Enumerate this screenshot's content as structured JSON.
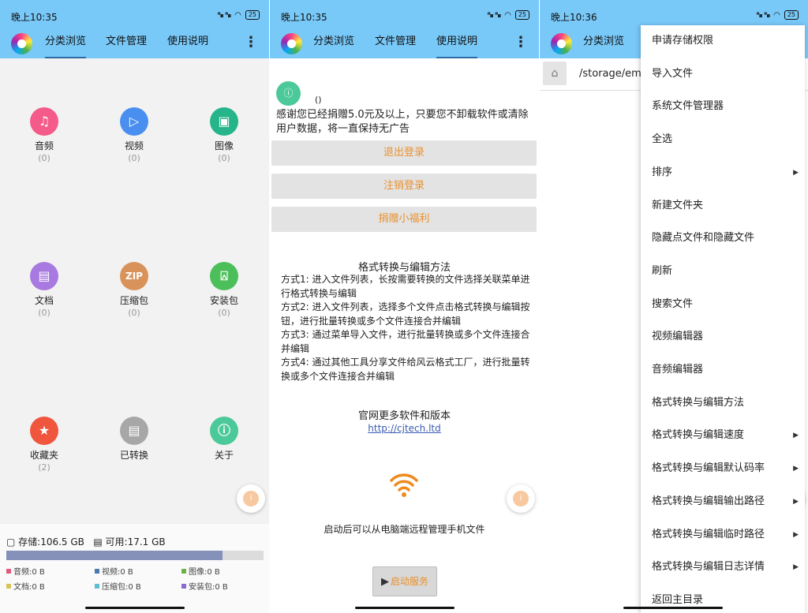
{
  "status": {
    "times": [
      "晚上10:35",
      "晚上10:35",
      "晚上10:36"
    ],
    "signal": "ᵃᵢₗₗ ᵃᵢₗₗ",
    "wifi": "📶",
    "battery": "25"
  },
  "tabs": [
    "分类浏览",
    "文件管理",
    "使用说明"
  ],
  "categories": [
    {
      "label": "音频",
      "count": "(0)",
      "icon": "♫",
      "color": "#f45a8a"
    },
    {
      "label": "视频",
      "count": "(0)",
      "icon": "▷",
      "color": "#4a8ff0"
    },
    {
      "label": "图像",
      "count": "(0)",
      "icon": "▣",
      "color": "#26b58a"
    },
    {
      "label": "文档",
      "count": "(0)",
      "icon": "▤",
      "color": "#a879e0"
    },
    {
      "label": "压缩包",
      "count": "(0)",
      "icon": "ZIP",
      "color": "#d9925a"
    },
    {
      "label": "安装包",
      "count": "(0)",
      "icon": "⍓",
      "color": "#4cbf5a"
    },
    {
      "label": "收藏夹",
      "count": "(2)",
      "icon": "★",
      "color": "#f0553d"
    },
    {
      "label": "已转换",
      "count": "",
      "icon": "▤",
      "color": "#a7a7a7"
    },
    {
      "label": "关于",
      "count": "",
      "icon": "ⓘ",
      "color": "#4cc99a"
    }
  ],
  "storage": {
    "total": "存储:106.5 GB",
    "available": "可用:17.1 GB",
    "used_fraction": 0.84,
    "legend": [
      {
        "label": "音频:0 B",
        "color": "#e05b7b"
      },
      {
        "label": "视频:0 B",
        "color": "#4a7ab0"
      },
      {
        "label": "图像:0 B",
        "color": "#6cb04a"
      },
      {
        "label": "文档:0 B",
        "color": "#d8c35a"
      },
      {
        "label": "压缩包:0 B",
        "color": "#5ac0d0"
      },
      {
        "label": "安装包:0 B",
        "color": "#8a6ad0"
      }
    ]
  },
  "about": {
    "paren": "()",
    "thanks": "感谢您已经捐赠5.0元及以上，只要您不卸载软件或清除用户数据，将一直保持无广告",
    "buttons": [
      "退出登录",
      "注销登录",
      "捐赠小福利"
    ],
    "howto_title": "格式转换与编辑方法",
    "howto_lines": [
      "方式1: 进入文件列表，长按需要转换的文件选择关联菜单进行格式转换与编辑",
      "方式2: 进入文件列表，选择多个文件点击格式转换与编辑按钮，进行批量转换或多个文件连接合并编辑",
      "方式3: 通过菜单导入文件，进行批量转换或多个文件连接合并编辑",
      "方式4: 通过其他工具分享文件给风云格式工厂，进行批量转换或多个文件连接合并编辑"
    ],
    "site_title": "官网更多软件和版本",
    "site_link": "http://cjtech.ltd",
    "remote_text": "启动后可以从电脑端远程管理手机文件",
    "start_label": "启动服务"
  },
  "filemgr": {
    "tab": "分类浏览",
    "path": "/storage/emu"
  },
  "menu": [
    {
      "label": "申请存储权限",
      "arrow": false
    },
    {
      "label": "导入文件",
      "arrow": false
    },
    {
      "label": "系统文件管理器",
      "arrow": false
    },
    {
      "label": "全选",
      "arrow": false
    },
    {
      "label": "排序",
      "arrow": true
    },
    {
      "label": "新建文件夹",
      "arrow": false
    },
    {
      "label": "隐藏点文件和隐藏文件",
      "arrow": false
    },
    {
      "label": "刷新",
      "arrow": false
    },
    {
      "label": "搜索文件",
      "arrow": false
    },
    {
      "label": "视频编辑器",
      "arrow": false
    },
    {
      "label": "音频编辑器",
      "arrow": false
    },
    {
      "label": "格式转换与编辑方法",
      "arrow": false
    },
    {
      "label": "格式转换与编辑速度",
      "arrow": true
    },
    {
      "label": "格式转换与编辑默认码率",
      "arrow": true
    },
    {
      "label": "格式转换与编辑输出路径",
      "arrow": true
    },
    {
      "label": "格式转换与编辑临时路径",
      "arrow": true
    },
    {
      "label": "格式转换与编辑日志详情",
      "arrow": true
    },
    {
      "label": "返回主目录",
      "arrow": false
    }
  ]
}
